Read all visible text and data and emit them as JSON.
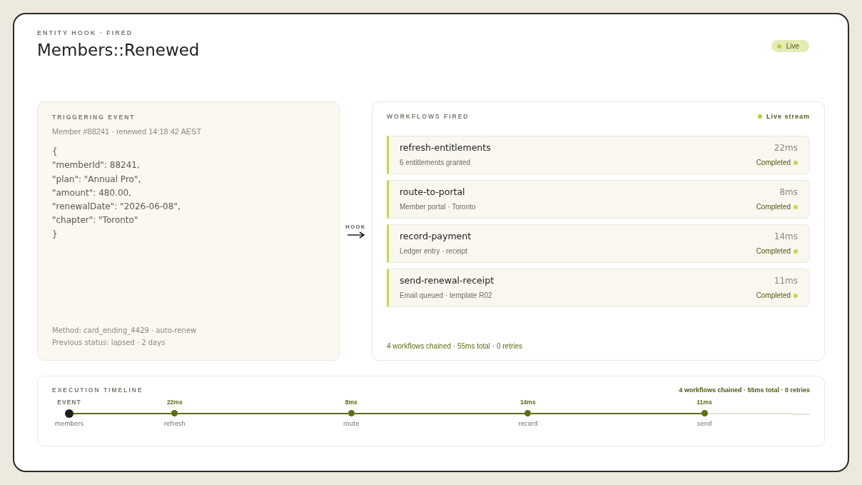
{
  "header": {
    "eyebrow": "ENTITY HOOK · FIRED",
    "title": "Members::Renewed",
    "status": {
      "label": "Live",
      "live": true
    }
  },
  "trigger": {
    "heading": "TRIGGERING EVENT",
    "subtitle": "Member #88241 · renewed 14:18:42 AEST",
    "payload_lines": [
      "{",
      "\"memberId\": 88241,",
      "\"plan\": \"Annual Pro\",",
      "\"amount\": 480.00,",
      "\"renewalDate\": \"2026-06-08\",",
      "\"chapter\": \"Toronto\"",
      "}"
    ],
    "footer_lines": [
      "Method: card_ending_4429 · auto-renew",
      "Previous status: lapsed · 2 days"
    ]
  },
  "connector": {
    "label": "HOOK"
  },
  "workflows": {
    "heading": "WORKFLOWS FIRED",
    "stream": {
      "label": "Live stream",
      "live": true
    },
    "items": [
      {
        "name": "refresh-entitlements",
        "duration": "22ms",
        "detail": "6 entitlements granted",
        "status": "Completed",
        "color": "#c2d94e"
      },
      {
        "name": "route-to-portal",
        "duration": "8ms",
        "detail": "Member portal · Toronto",
        "status": "Completed",
        "color": "#c2d94e"
      },
      {
        "name": "record-payment",
        "duration": "14ms",
        "detail": "Ledger entry · receipt",
        "status": "Completed",
        "color": "#c2d94e"
      },
      {
        "name": "send-renewal-receipt",
        "duration": "11ms",
        "detail": "Email queued · template R02",
        "status": "Completed",
        "color": "#c2d94e"
      }
    ],
    "summary": "4 workflows chained · 55ms total · 0 retries"
  },
  "timeline": {
    "heading": "EXECUTION TIMELINE",
    "summary": "4 workflows chained · 55ms total · 0 retries",
    "stops": [
      {
        "kind": "event",
        "top": "EVENT",
        "label": "members"
      },
      {
        "kind": "workflow",
        "top": "22ms",
        "label": "refresh",
        "completed": true
      },
      {
        "kind": "workflow",
        "top": "8ms",
        "label": "route",
        "completed": true
      },
      {
        "kind": "workflow",
        "top": "14ms",
        "label": "record",
        "completed": true
      },
      {
        "kind": "workflow",
        "top": "11ms",
        "label": "send",
        "completed": true
      }
    ]
  }
}
